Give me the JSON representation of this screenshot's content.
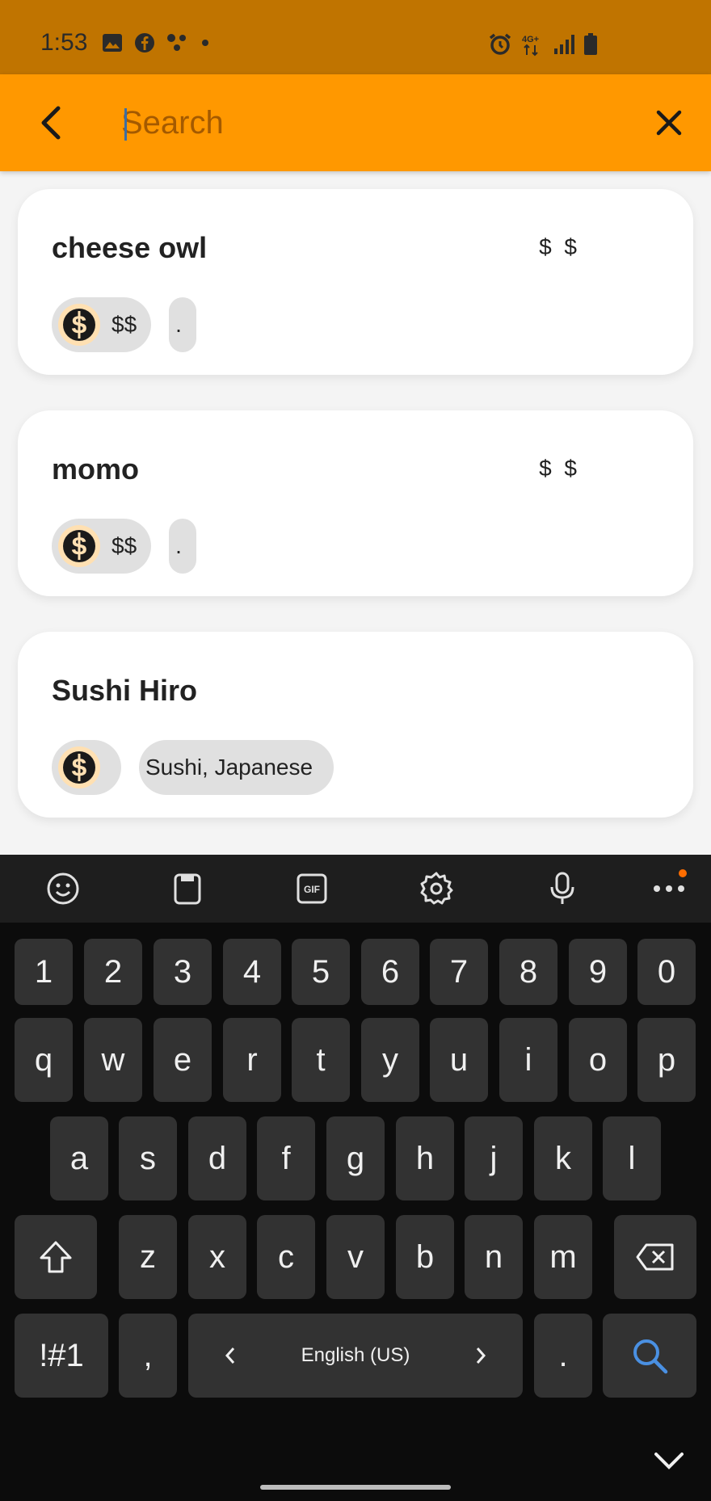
{
  "status_bar": {
    "time": "1:53",
    "network": "4G+"
  },
  "search": {
    "placeholder": "Search",
    "value": ""
  },
  "results": [
    {
      "name": "cheese owl",
      "price": "$ $",
      "price_chip": "$$",
      "category_chip": "."
    },
    {
      "name": "momo",
      "price": "$ $",
      "price_chip": "$$",
      "category_chip": "."
    },
    {
      "name": "Sushi Hiro",
      "price": "",
      "price_chip": "",
      "category_chip": "Sushi, Japanese"
    }
  ],
  "keyboard": {
    "toolbar": [
      "emoji-icon",
      "clipboard-icon",
      "gif-icon",
      "settings-icon",
      "mic-icon",
      "more-icon"
    ],
    "row_numbers": [
      "1",
      "2",
      "3",
      "4",
      "5",
      "6",
      "7",
      "8",
      "9",
      "0"
    ],
    "row1": [
      "q",
      "w",
      "e",
      "r",
      "t",
      "y",
      "u",
      "i",
      "o",
      "p"
    ],
    "row2": [
      "a",
      "s",
      "d",
      "f",
      "g",
      "h",
      "j",
      "k",
      "l"
    ],
    "row3": [
      "z",
      "x",
      "c",
      "v",
      "b",
      "n",
      "m"
    ],
    "symbols_key": "!#1",
    "comma_key": ",",
    "period_key": ".",
    "space_label": "English (US)"
  },
  "colors": {
    "primary": "#ff9800",
    "status_bar": "#c07400",
    "search_key": "#4a90e2"
  }
}
